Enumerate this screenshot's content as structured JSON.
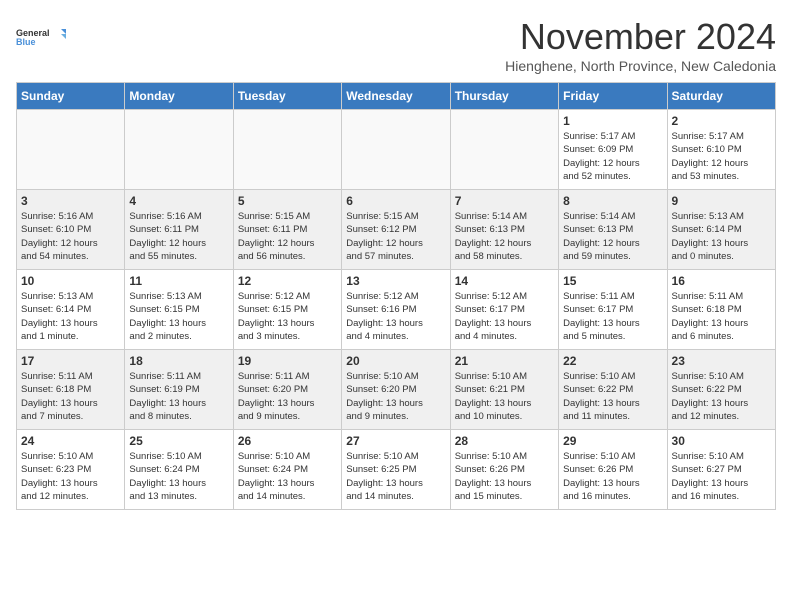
{
  "logo": {
    "line1": "General",
    "line2": "Blue"
  },
  "title": "November 2024",
  "subtitle": "Hienghene, North Province, New Caledonia",
  "weekdays": [
    "Sunday",
    "Monday",
    "Tuesday",
    "Wednesday",
    "Thursday",
    "Friday",
    "Saturday"
  ],
  "weeks": [
    [
      {
        "day": "",
        "text": ""
      },
      {
        "day": "",
        "text": ""
      },
      {
        "day": "",
        "text": ""
      },
      {
        "day": "",
        "text": ""
      },
      {
        "day": "",
        "text": ""
      },
      {
        "day": "1",
        "text": "Sunrise: 5:17 AM\nSunset: 6:09 PM\nDaylight: 12 hours\nand 52 minutes."
      },
      {
        "day": "2",
        "text": "Sunrise: 5:17 AM\nSunset: 6:10 PM\nDaylight: 12 hours\nand 53 minutes."
      }
    ],
    [
      {
        "day": "3",
        "text": "Sunrise: 5:16 AM\nSunset: 6:10 PM\nDaylight: 12 hours\nand 54 minutes."
      },
      {
        "day": "4",
        "text": "Sunrise: 5:16 AM\nSunset: 6:11 PM\nDaylight: 12 hours\nand 55 minutes."
      },
      {
        "day": "5",
        "text": "Sunrise: 5:15 AM\nSunset: 6:11 PM\nDaylight: 12 hours\nand 56 minutes."
      },
      {
        "day": "6",
        "text": "Sunrise: 5:15 AM\nSunset: 6:12 PM\nDaylight: 12 hours\nand 57 minutes."
      },
      {
        "day": "7",
        "text": "Sunrise: 5:14 AM\nSunset: 6:13 PM\nDaylight: 12 hours\nand 58 minutes."
      },
      {
        "day": "8",
        "text": "Sunrise: 5:14 AM\nSunset: 6:13 PM\nDaylight: 12 hours\nand 59 minutes."
      },
      {
        "day": "9",
        "text": "Sunrise: 5:13 AM\nSunset: 6:14 PM\nDaylight: 13 hours\nand 0 minutes."
      }
    ],
    [
      {
        "day": "10",
        "text": "Sunrise: 5:13 AM\nSunset: 6:14 PM\nDaylight: 13 hours\nand 1 minute."
      },
      {
        "day": "11",
        "text": "Sunrise: 5:13 AM\nSunset: 6:15 PM\nDaylight: 13 hours\nand 2 minutes."
      },
      {
        "day": "12",
        "text": "Sunrise: 5:12 AM\nSunset: 6:15 PM\nDaylight: 13 hours\nand 3 minutes."
      },
      {
        "day": "13",
        "text": "Sunrise: 5:12 AM\nSunset: 6:16 PM\nDaylight: 13 hours\nand 4 minutes."
      },
      {
        "day": "14",
        "text": "Sunrise: 5:12 AM\nSunset: 6:17 PM\nDaylight: 13 hours\nand 4 minutes."
      },
      {
        "day": "15",
        "text": "Sunrise: 5:11 AM\nSunset: 6:17 PM\nDaylight: 13 hours\nand 5 minutes."
      },
      {
        "day": "16",
        "text": "Sunrise: 5:11 AM\nSunset: 6:18 PM\nDaylight: 13 hours\nand 6 minutes."
      }
    ],
    [
      {
        "day": "17",
        "text": "Sunrise: 5:11 AM\nSunset: 6:18 PM\nDaylight: 13 hours\nand 7 minutes."
      },
      {
        "day": "18",
        "text": "Sunrise: 5:11 AM\nSunset: 6:19 PM\nDaylight: 13 hours\nand 8 minutes."
      },
      {
        "day": "19",
        "text": "Sunrise: 5:11 AM\nSunset: 6:20 PM\nDaylight: 13 hours\nand 9 minutes."
      },
      {
        "day": "20",
        "text": "Sunrise: 5:10 AM\nSunset: 6:20 PM\nDaylight: 13 hours\nand 9 minutes."
      },
      {
        "day": "21",
        "text": "Sunrise: 5:10 AM\nSunset: 6:21 PM\nDaylight: 13 hours\nand 10 minutes."
      },
      {
        "day": "22",
        "text": "Sunrise: 5:10 AM\nSunset: 6:22 PM\nDaylight: 13 hours\nand 11 minutes."
      },
      {
        "day": "23",
        "text": "Sunrise: 5:10 AM\nSunset: 6:22 PM\nDaylight: 13 hours\nand 12 minutes."
      }
    ],
    [
      {
        "day": "24",
        "text": "Sunrise: 5:10 AM\nSunset: 6:23 PM\nDaylight: 13 hours\nand 12 minutes."
      },
      {
        "day": "25",
        "text": "Sunrise: 5:10 AM\nSunset: 6:24 PM\nDaylight: 13 hours\nand 13 minutes."
      },
      {
        "day": "26",
        "text": "Sunrise: 5:10 AM\nSunset: 6:24 PM\nDaylight: 13 hours\nand 14 minutes."
      },
      {
        "day": "27",
        "text": "Sunrise: 5:10 AM\nSunset: 6:25 PM\nDaylight: 13 hours\nand 14 minutes."
      },
      {
        "day": "28",
        "text": "Sunrise: 5:10 AM\nSunset: 6:26 PM\nDaylight: 13 hours\nand 15 minutes."
      },
      {
        "day": "29",
        "text": "Sunrise: 5:10 AM\nSunset: 6:26 PM\nDaylight: 13 hours\nand 16 minutes."
      },
      {
        "day": "30",
        "text": "Sunrise: 5:10 AM\nSunset: 6:27 PM\nDaylight: 13 hours\nand 16 minutes."
      }
    ]
  ]
}
